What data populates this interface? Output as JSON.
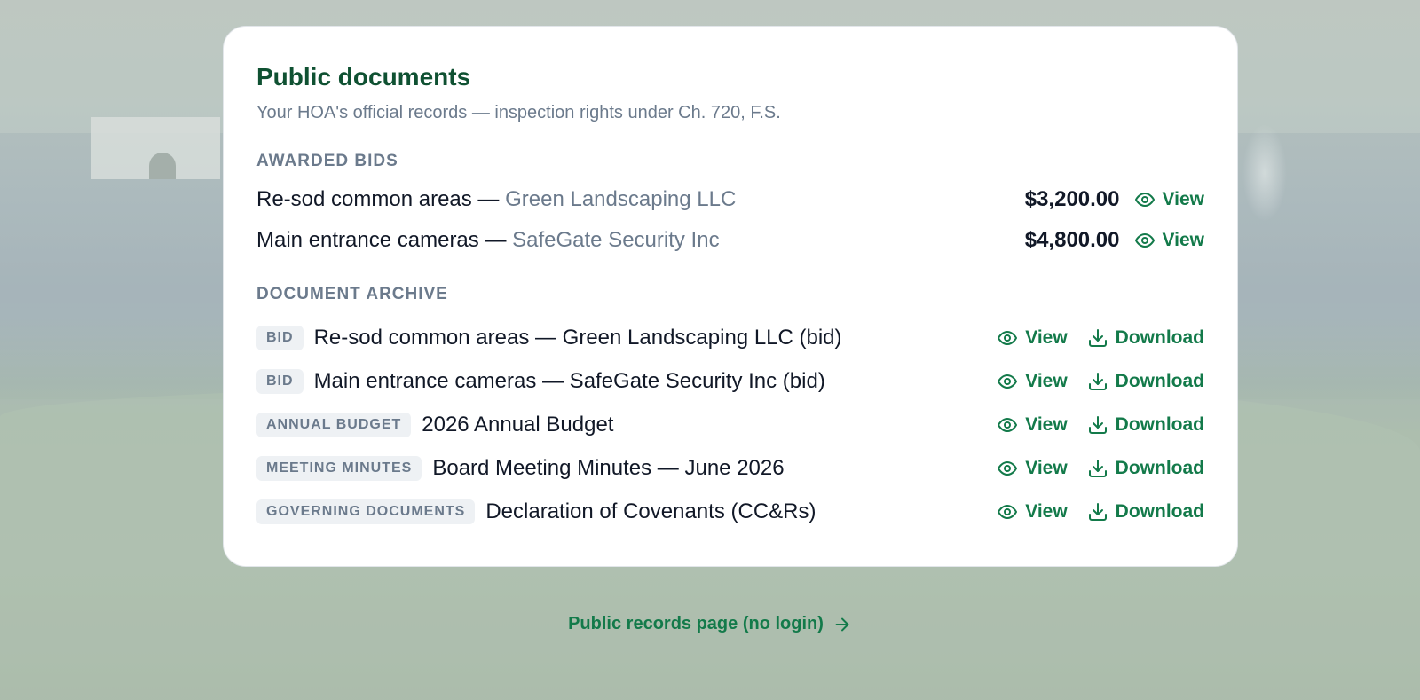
{
  "card": {
    "title": "Public documents",
    "subtitle": "Your HOA's official records — inspection rights under Ch. 720, F.S."
  },
  "awarded_bids": {
    "heading": "AWARDED BIDS",
    "items": [
      {
        "description": "Re-sod common areas — ",
        "vendor": "Green Landscaping LLC",
        "amount": "$3,200.00",
        "view_label": "View"
      },
      {
        "description": "Main entrance cameras — ",
        "vendor": "SafeGate Security Inc",
        "amount": "$4,800.00",
        "view_label": "View"
      }
    ]
  },
  "archive": {
    "heading": "DOCUMENT ARCHIVE",
    "items": [
      {
        "tag": "BID",
        "title": "Re-sod common areas — Green Landscaping LLC (bid)",
        "view_label": "View",
        "download_label": "Download"
      },
      {
        "tag": "BID",
        "title": "Main entrance cameras — SafeGate Security Inc (bid)",
        "view_label": "View",
        "download_label": "Download"
      },
      {
        "tag": "ANNUAL BUDGET",
        "title": "2026 Annual Budget",
        "view_label": "View",
        "download_label": "Download"
      },
      {
        "tag": "MEETING MINUTES",
        "title": "Board Meeting Minutes — June 2026",
        "view_label": "View",
        "download_label": "Download"
      },
      {
        "tag": "GOVERNING DOCUMENTS",
        "title": "Declaration of Covenants (CC&Rs)",
        "view_label": "View",
        "download_label": "Download"
      }
    ]
  },
  "footer": {
    "link_label": "Public records page (no login)"
  },
  "icons": {
    "view": "eye-icon",
    "download": "download-icon",
    "arrow": "arrow-right-icon"
  },
  "colors": {
    "accent": "#137a4a",
    "title": "#0f5132",
    "muted": "#6b7a8c",
    "text": "#111827"
  }
}
